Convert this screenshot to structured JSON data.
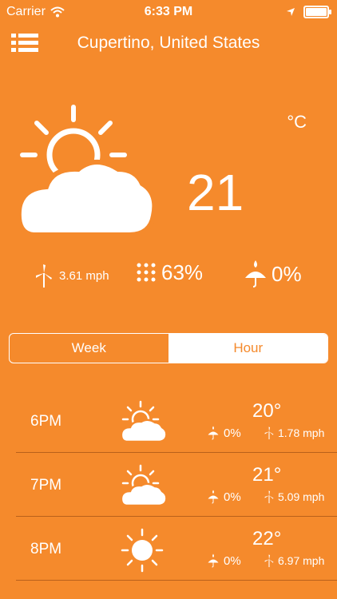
{
  "status": {
    "carrier": "Carrier",
    "time": "6:33 PM"
  },
  "header": {
    "location": "Cupertino, United States"
  },
  "current": {
    "unit": "°C",
    "temp": "21",
    "wind": "3.61 mph",
    "humidity": "63%",
    "rain": "0%"
  },
  "tabs": {
    "week": "Week",
    "hour": "Hour",
    "selected": "Hour"
  },
  "hours": [
    {
      "hour": "6PM",
      "temp": "20°",
      "rain": "0%",
      "wind": "1.78 mph",
      "icon": "partly-cloudy-icon"
    },
    {
      "hour": "7PM",
      "temp": "21°",
      "rain": "0%",
      "wind": "5.09 mph",
      "icon": "partly-cloudy-icon"
    },
    {
      "hour": "8PM",
      "temp": "22°",
      "rain": "0%",
      "wind": "6.97 mph",
      "icon": "sun-icon"
    }
  ],
  "colors": {
    "background": "#F58A2C",
    "foreground": "#FFFFFF"
  }
}
